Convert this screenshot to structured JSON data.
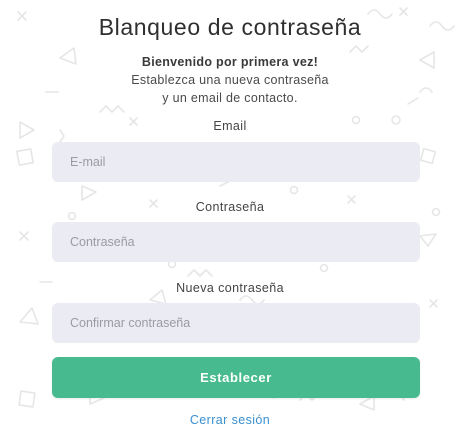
{
  "page": {
    "title": "Blanqueo de contraseña",
    "welcome": "Bienvenido por primera vez!",
    "description_line1": "Establezca una nueva contraseña",
    "description_line2": "y un email de contacto."
  },
  "form": {
    "email": {
      "label": "Email",
      "placeholder": "E-mail",
      "value": ""
    },
    "password": {
      "label": "Contraseña",
      "placeholder": "Contraseña",
      "value": ""
    },
    "new_password": {
      "label": "Nueva contraseña",
      "placeholder": "Confirmar contraseña",
      "value": ""
    },
    "submit_label": "Establecer"
  },
  "footer": {
    "logout_label": "Cerrar sesión"
  },
  "colors": {
    "accent": "#47bb8f",
    "link": "#3a8fd0",
    "input_bg": "#ebebf3",
    "pattern": "#e7e7e7"
  }
}
